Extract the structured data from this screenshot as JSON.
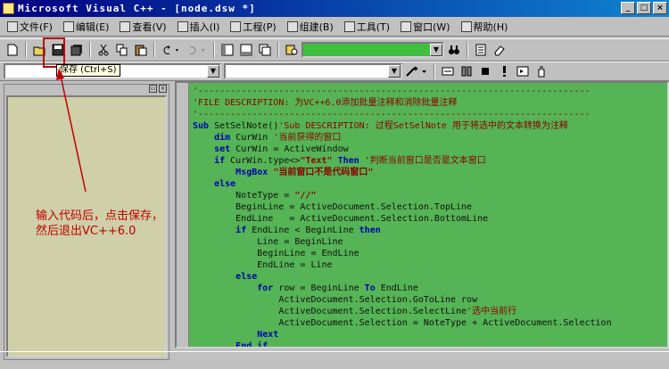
{
  "window": {
    "title": "Microsoft Visual C++ - [node.dsw *]",
    "min": "_",
    "max": "□",
    "close": "×"
  },
  "menu": [
    {
      "label": "文件(F)",
      "icon": "file-menu-icon"
    },
    {
      "label": "编辑(E)",
      "icon": "edit-menu-icon"
    },
    {
      "label": "查看(V)",
      "icon": "view-menu-icon"
    },
    {
      "label": "插入(I)",
      "icon": "insert-menu-icon"
    },
    {
      "label": "工程(P)",
      "icon": "project-menu-icon"
    },
    {
      "label": "组建(B)",
      "icon": "build-menu-icon"
    },
    {
      "label": "工具(T)",
      "icon": "tools-menu-icon"
    },
    {
      "label": "窗口(W)",
      "icon": "window-menu-icon"
    },
    {
      "label": "帮助(H)",
      "icon": "help-menu-icon"
    }
  ],
  "tooltip": {
    "text": "保存 (Ctrl+S)"
  },
  "annotation": {
    "line1": "输入代码后，点击保存，",
    "line2": "然后退出VC++6.0"
  },
  "code": [
    {
      "segs": [
        {
          "t": "'-------------------------------------------------------------------------",
          "c": "c-comment"
        }
      ]
    },
    {
      "segs": [
        {
          "t": "'FILE DESCRIPTION: 为VC++6.0添加批量注释和消除批量注释",
          "c": "c-comment"
        }
      ]
    },
    {
      "segs": [
        {
          "t": "'-------------------------------------------------------------------------",
          "c": "c-comment"
        }
      ]
    },
    {
      "segs": [
        {
          "t": "Sub ",
          "c": "c-kw"
        },
        {
          "t": "SetSelNote()"
        },
        {
          "t": "'Sub DESCRIPTION: 过程SetSelNote 用于将选中的文本转换为注释",
          "c": "c-comment"
        }
      ]
    },
    {
      "segs": [
        {
          "t": "    "
        },
        {
          "t": "dim ",
          "c": "c-kw"
        },
        {
          "t": "CurWin "
        },
        {
          "t": "'当前获得的窗口",
          "c": "c-comment"
        }
      ]
    },
    {
      "segs": [
        {
          "t": "    "
        },
        {
          "t": "set ",
          "c": "c-kw"
        },
        {
          "t": "CurWin = ActiveWindow"
        }
      ]
    },
    {
      "segs": [
        {
          "t": "    "
        },
        {
          "t": "if ",
          "c": "c-kw"
        },
        {
          "t": "CurWin.type<>"
        },
        {
          "t": "\"Text\"",
          "c": "c-str"
        },
        {
          "t": " Then ",
          "c": "c-kw"
        },
        {
          "t": "'判断当前窗口是否是文本窗口",
          "c": "c-comment"
        }
      ]
    },
    {
      "segs": [
        {
          "t": "        "
        },
        {
          "t": "MsgBox ",
          "c": "c-kw"
        },
        {
          "t": "\"当前窗口不是代码窗口\"",
          "c": "c-str"
        }
      ]
    },
    {
      "segs": [
        {
          "t": "    "
        },
        {
          "t": "else",
          "c": "c-kw"
        }
      ]
    },
    {
      "segs": [
        {
          "t": "        NoteType = "
        },
        {
          "t": "\"//\"",
          "c": "c-str"
        }
      ]
    },
    {
      "segs": [
        {
          "t": "        BeginLine = ActiveDocument.Selection.TopLine"
        }
      ]
    },
    {
      "segs": [
        {
          "t": "        EndLine   = ActiveDocument.Selection.BottomLine"
        }
      ]
    },
    {
      "segs": [
        {
          "t": "        "
        },
        {
          "t": "if ",
          "c": "c-kw"
        },
        {
          "t": "EndLine < BeginLine "
        },
        {
          "t": "then",
          "c": "c-kw"
        }
      ]
    },
    {
      "segs": [
        {
          "t": "            Line = BeginLine"
        }
      ]
    },
    {
      "segs": [
        {
          "t": "            BeginLine = EndLine"
        }
      ]
    },
    {
      "segs": [
        {
          "t": "            EndLine = Line"
        }
      ]
    },
    {
      "segs": [
        {
          "t": "        "
        },
        {
          "t": "else",
          "c": "c-kw"
        }
      ]
    },
    {
      "segs": [
        {
          "t": "            "
        },
        {
          "t": "for ",
          "c": "c-kw"
        },
        {
          "t": "row = BeginLine "
        },
        {
          "t": "To ",
          "c": "c-kw"
        },
        {
          "t": "EndLine"
        }
      ]
    },
    {
      "segs": [
        {
          "t": "                ActiveDocument.Selection.GoToLine row"
        }
      ]
    },
    {
      "segs": [
        {
          "t": "                ActiveDocument.Selection.SelectLine"
        },
        {
          "t": "'选中当前行",
          "c": "c-comment"
        }
      ]
    },
    {
      "segs": [
        {
          "t": "                ActiveDocument.Selection = NoteType + ActiveDocument.Selection"
        }
      ]
    },
    {
      "segs": [
        {
          "t": "            "
        },
        {
          "t": "Next",
          "c": "c-kw"
        }
      ]
    },
    {
      "segs": [
        {
          "t": "        "
        },
        {
          "t": "End if",
          "c": "c-kw"
        }
      ]
    }
  ]
}
